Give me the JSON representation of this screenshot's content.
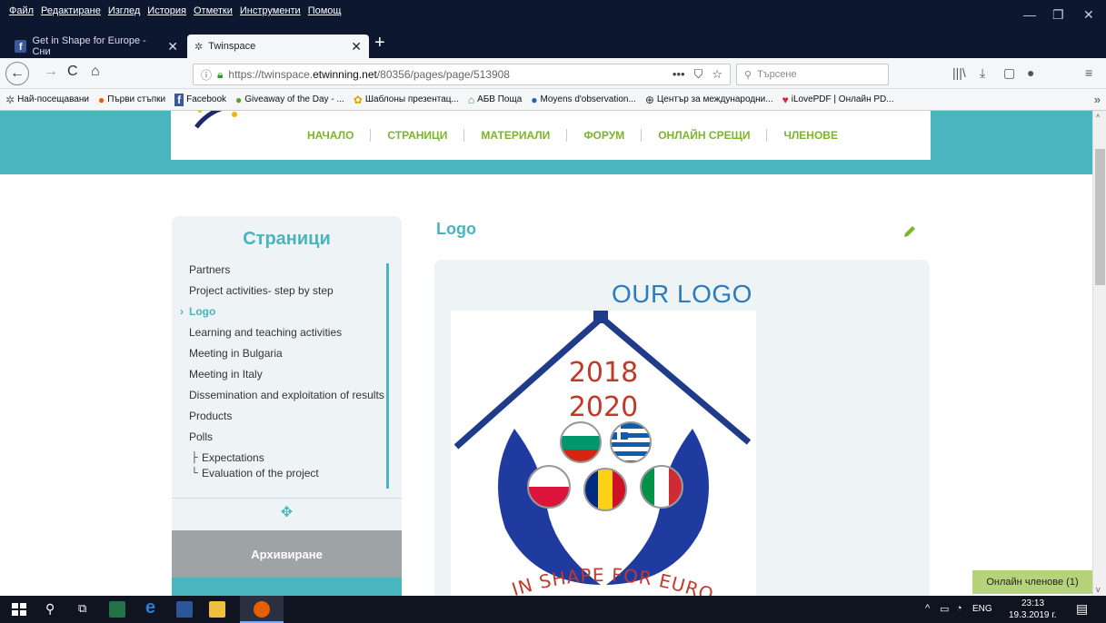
{
  "browser": {
    "menu": [
      "Файл",
      "Редактиране",
      "Изглед",
      "История",
      "Отметки",
      "Инструменти",
      "Помощ"
    ],
    "tabs": [
      {
        "label": "Get in Shape for Europe - Сни",
        "active": false
      },
      {
        "label": "Twinspace",
        "active": true
      }
    ],
    "url": {
      "prefix": "https://twinspace.",
      "domain": "etwinning.net",
      "path": "/80356/pages/page/513908"
    },
    "search_placeholder": "Търсене",
    "bookmarks": [
      {
        "label": "Най-посещавани",
        "icon": "gear-icon",
        "color": "#666666"
      },
      {
        "label": "Първи стъпки",
        "icon": "firefox-icon",
        "color": "#e66000"
      },
      {
        "label": "Facebook",
        "icon": "facebook-icon",
        "color": "#3b5998"
      },
      {
        "label": "Giveaway of the Day - ...",
        "icon": "giveaway-icon",
        "color": "#5a9e2f"
      },
      {
        "label": "Шаблоны презентац...",
        "icon": "flower-icon",
        "color": "#d9a400"
      },
      {
        "label": "АБВ Поща",
        "icon": "house-icon",
        "color": "#4aa040"
      },
      {
        "label": "Moyens d'observation...",
        "icon": "globe-icon",
        "color": "#1f5fbf"
      },
      {
        "label": "Център за международни...",
        "icon": "world-icon",
        "color": "#333333"
      },
      {
        "label": "iLovePDF | Онлайн PD...",
        "icon": "heart-icon",
        "color": "#d9243c"
      }
    ]
  },
  "site": {
    "nav": [
      "НАЧАЛО",
      "СТРАНИЦИ",
      "МАТЕРИАЛИ",
      "ФОРУМ",
      "ОНЛАЙН СРЕЩИ",
      "ЧЛЕНОВЕ"
    ],
    "sidebar": {
      "title": "Страници",
      "pages": [
        {
          "label": "Partners",
          "active": false
        },
        {
          "label": "Project activities- step by step",
          "active": false
        },
        {
          "label": "Logo",
          "active": true
        },
        {
          "label": "Learning and teaching activities",
          "active": false
        },
        {
          "label": "Meeting in Bulgaria",
          "active": false
        },
        {
          "label": "Meeting in Italy",
          "active": false
        },
        {
          "label": "Dissemination and exploitation of results",
          "active": false
        },
        {
          "label": "Products",
          "active": false
        },
        {
          "label": "Polls",
          "active": false
        }
      ],
      "subpages": [
        "Expectations",
        "Evaluation of the project"
      ],
      "archive_label": "Архивиране"
    },
    "content": {
      "title": "Logo",
      "heading": "OUR LOGO",
      "logo_years": [
        "2018",
        "2020"
      ],
      "logo_text": "IN SHAPE FOR EURO"
    },
    "online_members": "Онлайн членове (1)"
  },
  "taskbar": {
    "lang": "ENG",
    "time": "23:13",
    "date": "19.3.2019 г."
  }
}
